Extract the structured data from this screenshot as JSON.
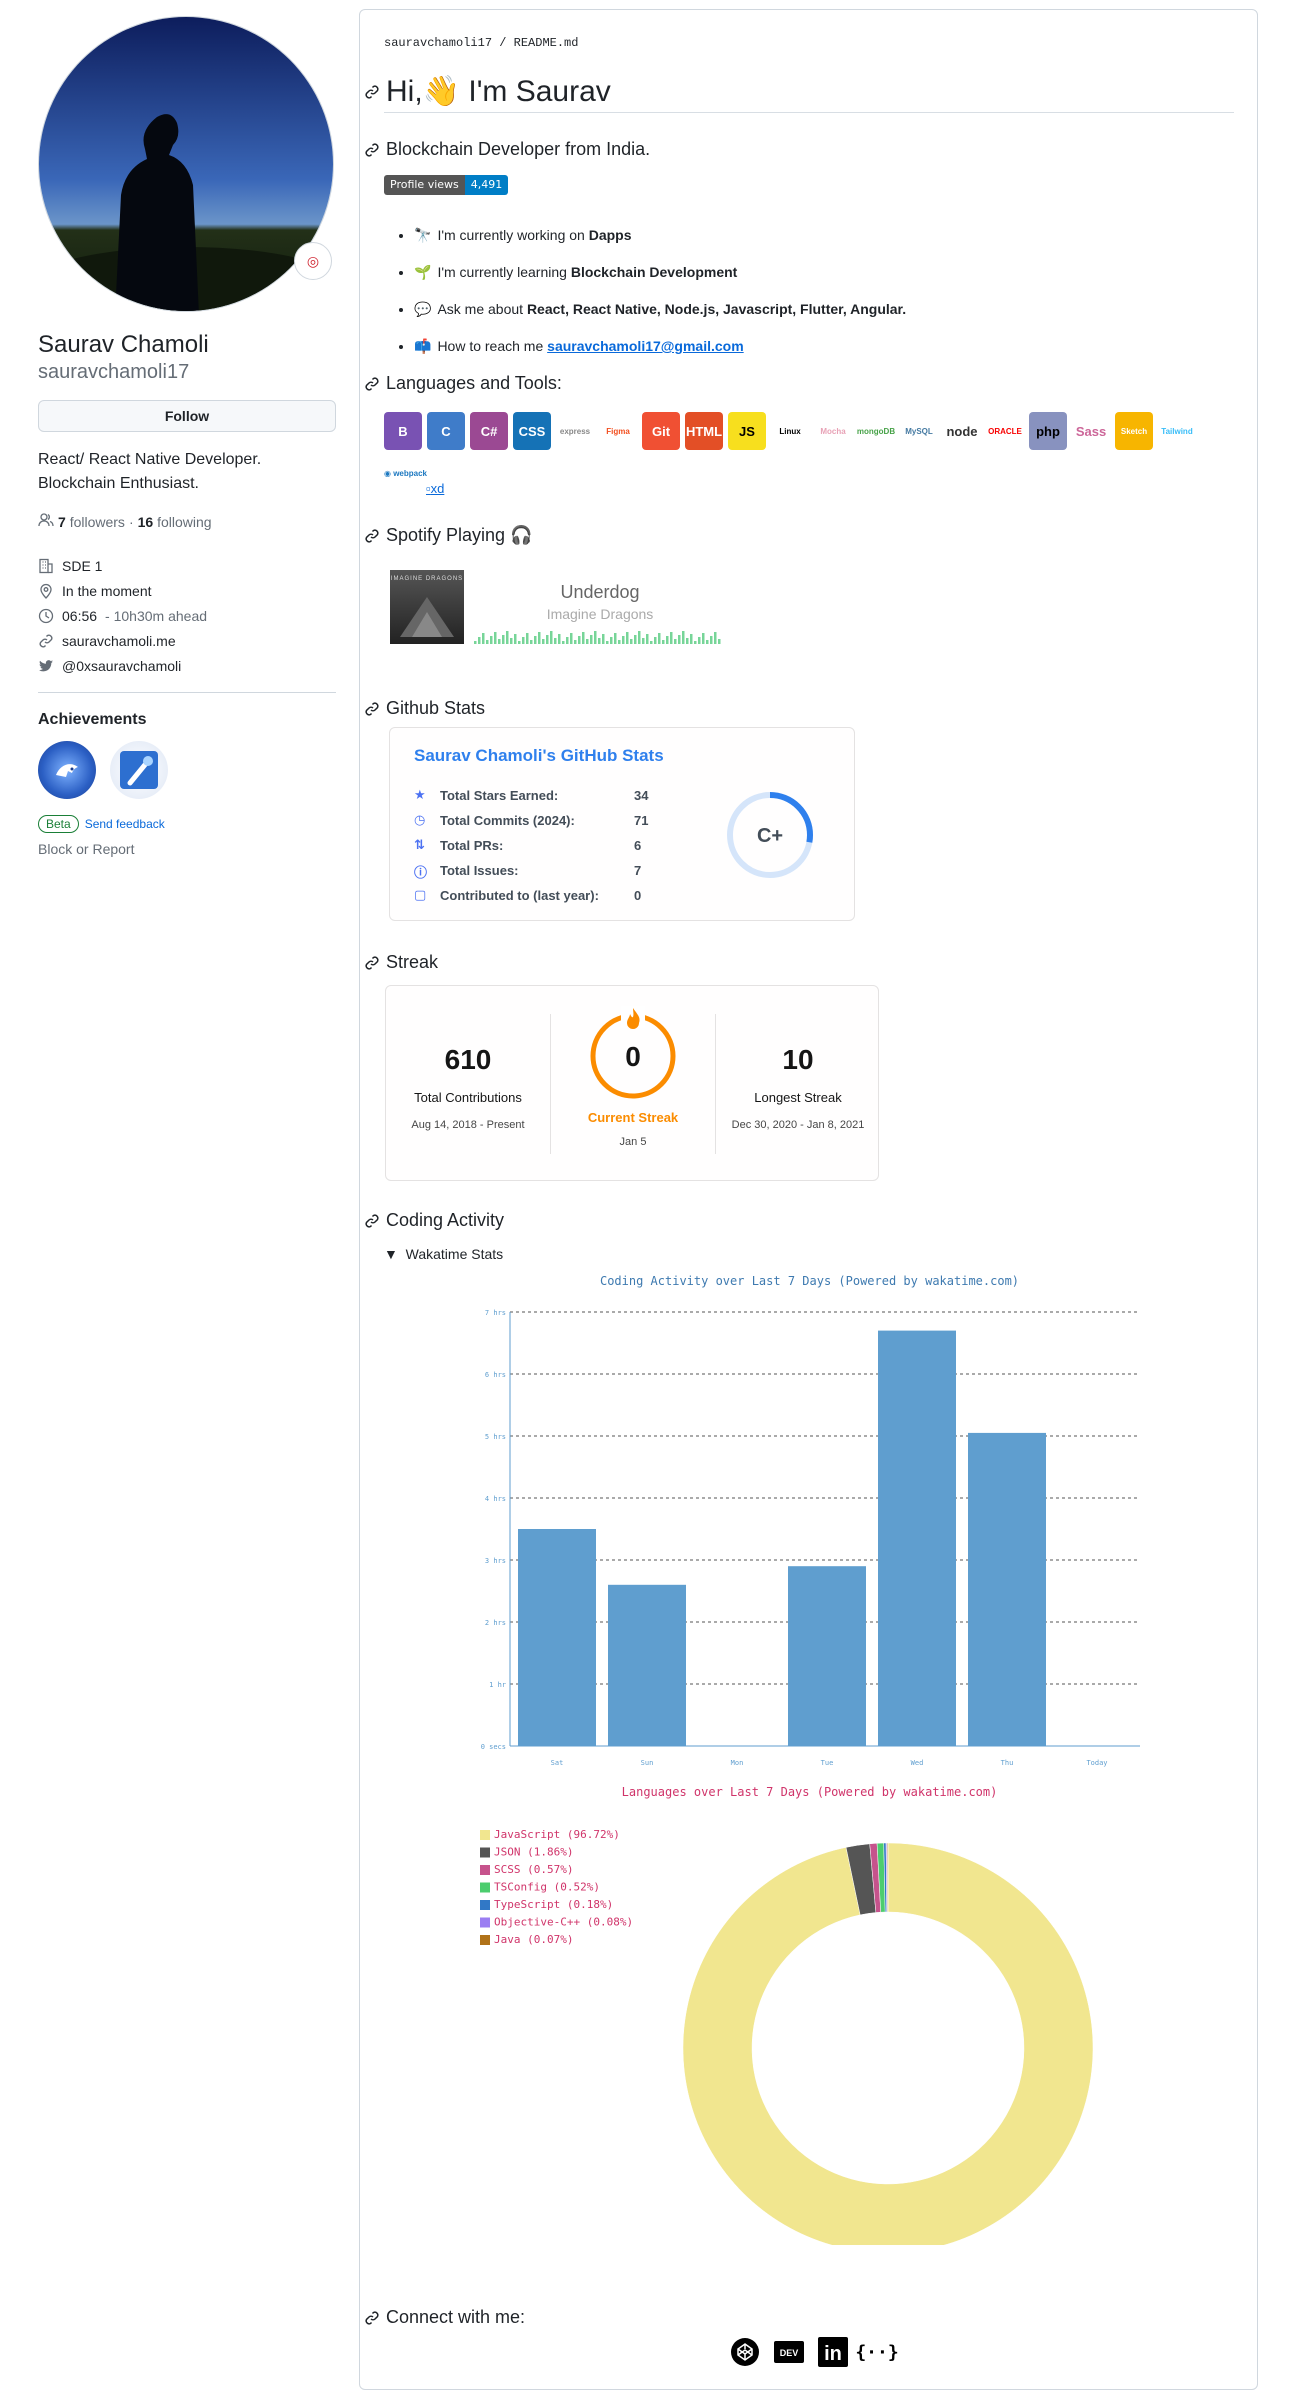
{
  "profile": {
    "name": "Saurav Chamoli",
    "login": "sauravchamoli17",
    "follow_label": "Follow",
    "bio_line1": "React/ React Native Developer.",
    "bio_line2": "Blockchain Enthusiast.",
    "followers_count": "7",
    "followers_label": "followers",
    "dot": "·",
    "following_count": "16",
    "following_label": "following",
    "company": "SDE 1",
    "location": "In the moment",
    "time": "06:56",
    "time_ahead": "- 10h30m ahead",
    "website": "sauravchamoli.me",
    "twitter": "@0xsauravchamoli",
    "achievements_title": "Achievements",
    "beta_label": "Beta",
    "feedback_label": "Send feedback",
    "block_label": "Block or Report"
  },
  "readme": {
    "path_user": "sauravchamoli17",
    "path_sep": " / ",
    "path_file": "README.md",
    "title": "Hi,👋  I'm Saurav",
    "subtitle": "Blockchain Developer from India.",
    "profile_views_label": "Profile views",
    "profile_views_value": "4,491",
    "bullets": [
      {
        "emoji": "🔭",
        "pre": "I'm currently working on ",
        "bold": "Dapps"
      },
      {
        "emoji": "🌱",
        "pre": "I'm currently learning ",
        "bold": "Blockchain Development"
      },
      {
        "emoji": "💬",
        "pre": "Ask me about ",
        "bold": "React, React Native, Node.js, Javascript, Flutter, Angular."
      },
      {
        "emoji": "📫",
        "pre": "How to reach me ",
        "link": "sauravchamoli17@gmail.com"
      }
    ],
    "tools_heading": "Languages and Tools:",
    "tools": [
      "B",
      "C",
      "C#",
      "CSS",
      "express",
      "Figma",
      "Git",
      "HTML",
      "JS",
      "Linux",
      "Mocha",
      "mongoDB",
      "MySQL",
      "node",
      "ORACLE",
      "php",
      "Sass",
      "Sketch",
      "Tailwind"
    ],
    "tools_extra1": "webpack",
    "tools_extra2": "xd",
    "spotify_heading": "Spotify Playing 🎧",
    "song": "Underdog",
    "artist": "Imagine Dragons",
    "album_text": "IMAGINE DRAGONS",
    "stats_heading": "Github Stats",
    "streak_heading": "Streak",
    "coding_heading": "Coding Activity",
    "details_summary": "Wakatime Stats",
    "connect_heading": "Connect with me:"
  },
  "github_stats": {
    "title": "Saurav Chamoli's GitHub Stats",
    "rows": [
      {
        "label": "Total Stars Earned:",
        "value": "34"
      },
      {
        "label": "Total Commits (2024):",
        "value": "71"
      },
      {
        "label": "Total PRs:",
        "value": "6"
      },
      {
        "label": "Total Issues:",
        "value": "7"
      },
      {
        "label": "Contributed to (last year):",
        "value": "0"
      }
    ],
    "grade": "C+"
  },
  "streak": {
    "total": "610",
    "total_label": "Total Contributions",
    "total_range": "Aug 14, 2018 - Present",
    "current": "0",
    "current_label": "Current Streak",
    "current_range": "Jan 5",
    "longest": "10",
    "longest_label": "Longest Streak",
    "longest_range": "Dec 30, 2020 - Jan 8, 2021"
  },
  "colors": {
    "bar": "#5f9ecf",
    "donut_js": "#f1e68f",
    "streak_orange": "#fb8c00",
    "stats_blue": "#2f80ed"
  },
  "chart_data": [
    {
      "type": "bar",
      "title": "Coding Activity over Last 7 Days (Powered by wakatime.com)",
      "categories": [
        "Sat",
        "Sun",
        "Mon",
        "Tue",
        "Wed",
        "Thu",
        "Today"
      ],
      "values": [
        3.5,
        2.6,
        0,
        2.9,
        6.7,
        5.05,
        0
      ],
      "ylim": [
        0,
        7
      ],
      "yticks": [
        "0 secs",
        "1 hr",
        "2 hrs",
        "3 hrs",
        "4 hrs",
        "5 hrs",
        "6 hrs",
        "7 hrs"
      ],
      "grid": true
    },
    {
      "type": "pie",
      "title": "Languages over Last 7 Days (Powered by wakatime.com)",
      "legend_position": "top-left",
      "slices": [
        {
          "label": "JavaScript (96.72%)",
          "value": 96.72,
          "color": "#f1e68f"
        },
        {
          "label": "JSON (1.86%)",
          "value": 1.86,
          "color": "#555555"
        },
        {
          "label": "SCSS (0.57%)",
          "value": 0.57,
          "color": "#c6538c"
        },
        {
          "label": "TSConfig (0.52%)",
          "value": 0.52,
          "color": "#4ccd6e"
        },
        {
          "label": "TypeScript (0.18%)",
          "value": 0.18,
          "color": "#3178c6"
        },
        {
          "label": "Objective-C++ (0.08%)",
          "value": 0.08,
          "color": "#9b7ef2"
        },
        {
          "label": "Java (0.07%)",
          "value": 0.07,
          "color": "#b07219"
        }
      ]
    }
  ]
}
